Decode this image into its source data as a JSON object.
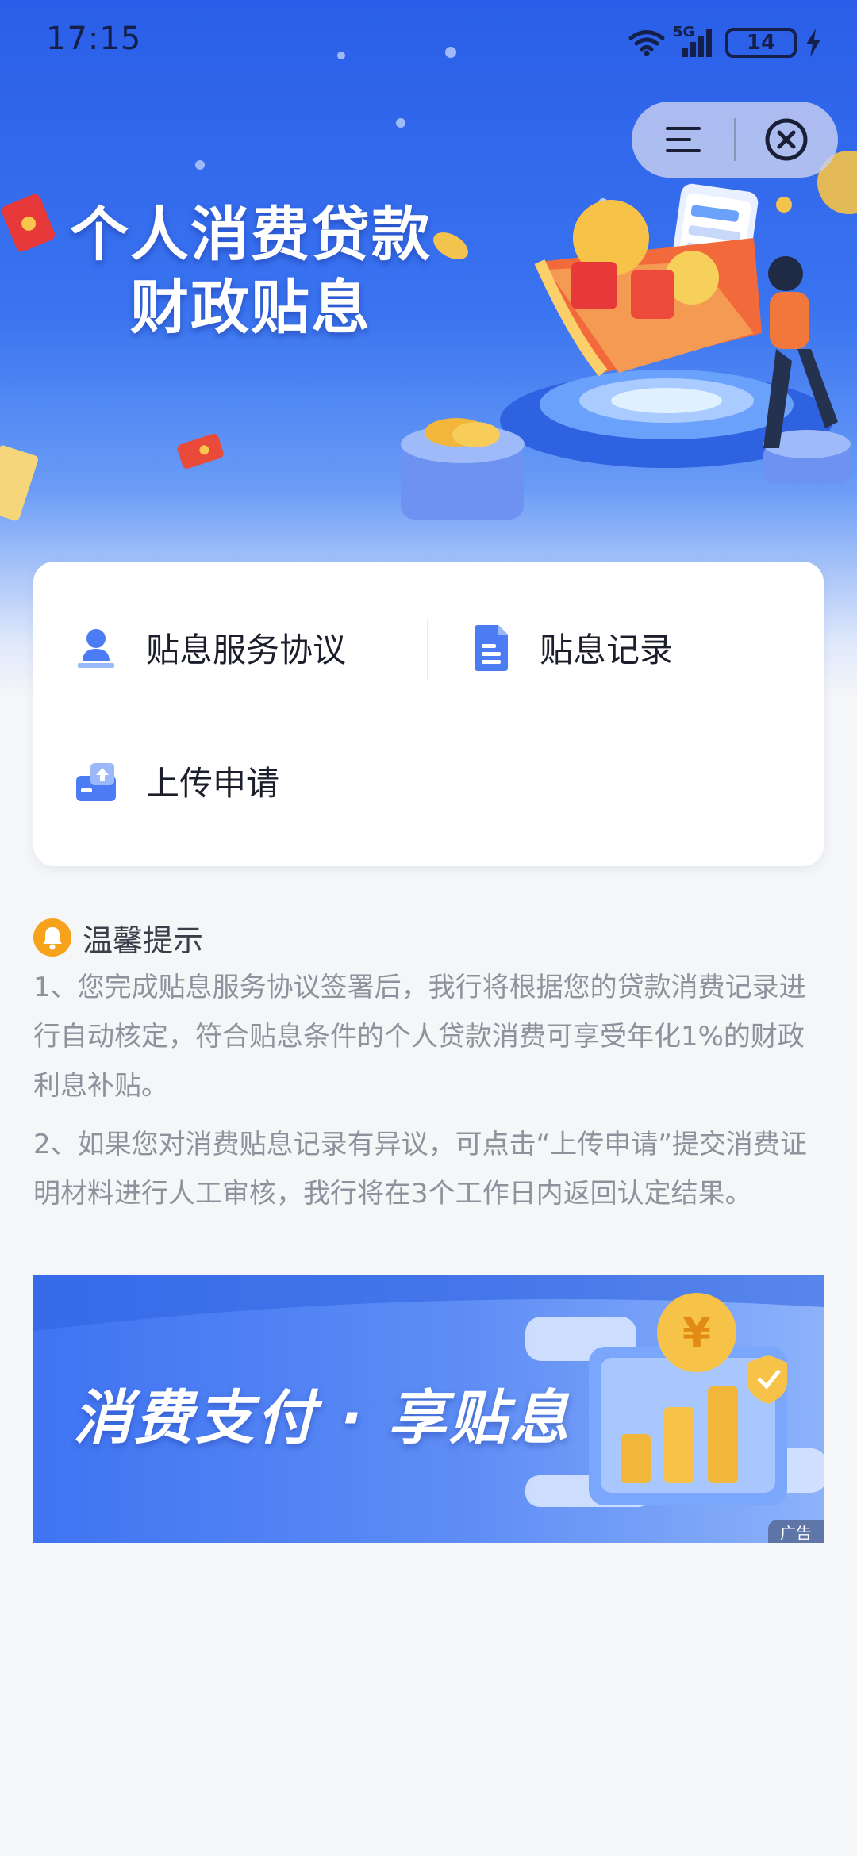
{
  "status_bar": {
    "time": "17:15",
    "network": "5G",
    "battery": "14"
  },
  "mini_program": {
    "menu_icon": "menu-icon",
    "close_icon": "close-circle-icon"
  },
  "hero": {
    "title_line1": "个人消费贷款",
    "title_line2": "财政贴息"
  },
  "services": [
    {
      "label": "贴息服务协议",
      "icon": "person-stamp-icon"
    },
    {
      "label": "贴息记录",
      "icon": "document-icon"
    },
    {
      "label": "上传申请",
      "icon": "upload-icon"
    }
  ],
  "tips": {
    "title": "温馨提示",
    "items": [
      "1、您完成贴息服务协议签署后，我行将根据您的贷款消费记录进行自动核定，符合贴息条件的个人贷款消费可享受年化1%的财政利息补贴。",
      "2、如果您对消费贴息记录有异议，可点击“上传申请”提交消费证明材料进行人工审核，我行将在3个工作日内返回认定结果。"
    ]
  },
  "banner": {
    "text": "消费支付 · 享贴息",
    "ad_label": "广告"
  },
  "colors": {
    "primary": "#3a74f0",
    "accent": "#f7a21b",
    "text": "#1c1f2b",
    "muted": "#8e929c"
  }
}
